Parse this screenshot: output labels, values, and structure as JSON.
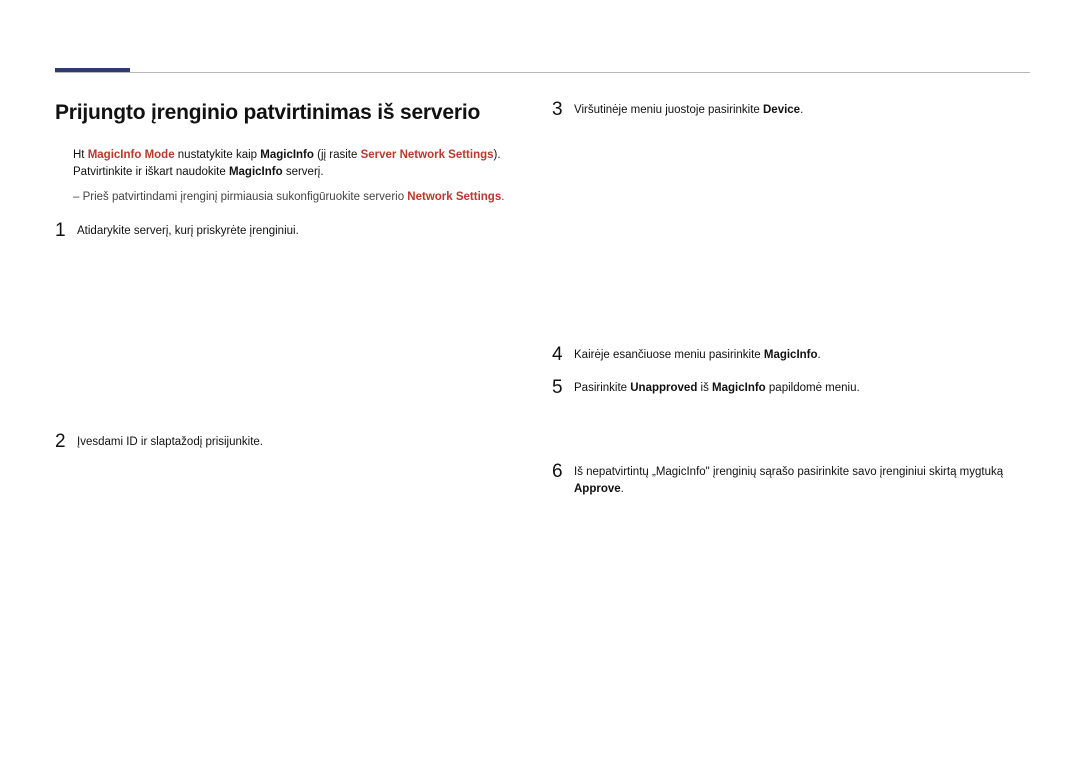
{
  "title": "Prijungto įrenginio patvirtinimas iš serverio",
  "intro": {
    "prefix": "Ht ",
    "mode_label": "MagicInfo Mode",
    "mid1": " nustatykite kaip ",
    "mode_val": "MagicInfo",
    "mid2": " (jį rasite ",
    "server": "Server",
    "mid3": " ",
    "net1": "Network Settings",
    "mid4": ").",
    "line2a": "Patvirtinkite ir iškart naudokite ",
    "line2b": "MagicInfo",
    "line2c": " serverį."
  },
  "note": {
    "t1": "Prieš patvirtindami įrenginį pirmiausia sukonfigūruokite serverio ",
    "net": "Network Settings",
    "t2": "."
  },
  "steps": {
    "s1": "Atidarykite serverį, kurį priskyrėte įrenginiui.",
    "s2": "Įvesdami ID ir slaptažodį prisijunkite.",
    "s3a": "Viršutinėje meniu juostoje pasirinkite ",
    "s3b": "Device",
    "s3c": ".",
    "s4a": "Kairėje esančiuose meniu pasirinkite ",
    "s4b": "MagicInfo",
    "s4c": ".",
    "s5a": "Pasirinkite ",
    "s5b": "Unapproved",
    "s5c": " iš ",
    "s5d": "MagicInfo",
    "s5e": " papildomė meniu.",
    "s6a": "Iš nepatvirtintų „MagicInfo\" įrenginių sąrašo pasirinkite savo įrenginiui skirtą mygtuką ",
    "s6b": "Approve",
    "s6c": "."
  }
}
